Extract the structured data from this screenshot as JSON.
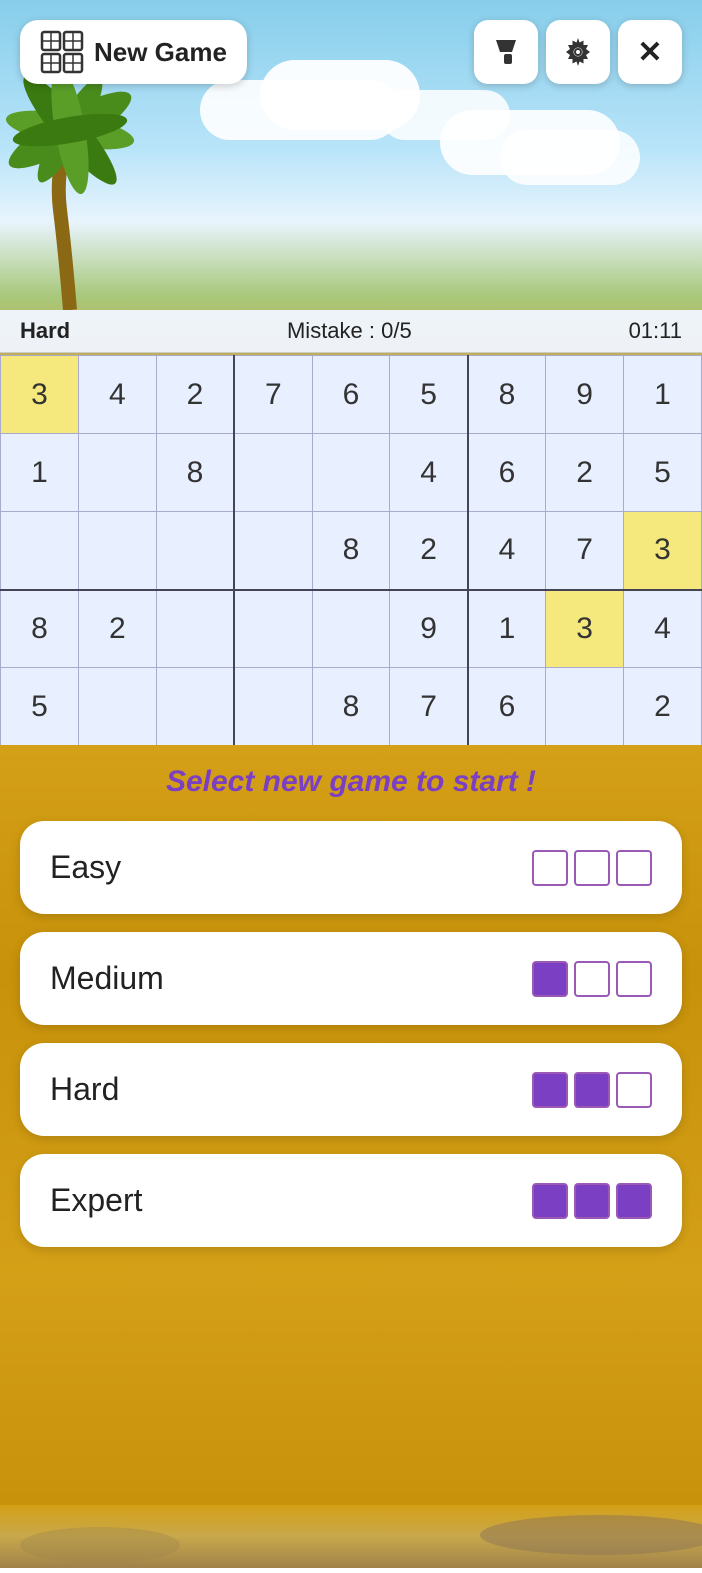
{
  "header": {
    "new_game_label": "New Game",
    "paint_icon": "🖌",
    "settings_icon": "⚙",
    "close_icon": "✕"
  },
  "status": {
    "difficulty": "Hard",
    "mistakes_label": "Mistake : 0/5",
    "timer": "01:11"
  },
  "sudoku": {
    "rows": [
      [
        "3",
        "4",
        "2",
        "7",
        "6",
        "5",
        "8",
        "9",
        "1"
      ],
      [
        "1",
        "",
        "8",
        "",
        "",
        "4",
        "6",
        "2",
        "5"
      ],
      [
        "",
        "",
        "",
        "",
        "8",
        "2",
        "4",
        "7",
        "3"
      ],
      [
        "8",
        "2",
        "",
        "",
        "",
        "9",
        "1",
        "3",
        "4"
      ],
      [
        "5",
        "",
        "",
        "",
        "8",
        "7",
        "6",
        "",
        "2"
      ]
    ],
    "highlighted": [
      [
        0,
        0
      ],
      [
        2,
        8
      ],
      [
        3,
        7
      ]
    ]
  },
  "overlay": {
    "select_text": "Select new game to start !",
    "difficulties": [
      {
        "label": "Easy",
        "filled": 0,
        "total": 3
      },
      {
        "label": "Medium",
        "filled": 1,
        "total": 3
      },
      {
        "label": "Hard",
        "filled": 2,
        "total": 3
      },
      {
        "label": "Expert",
        "filled": 3,
        "total": 3
      }
    ]
  }
}
